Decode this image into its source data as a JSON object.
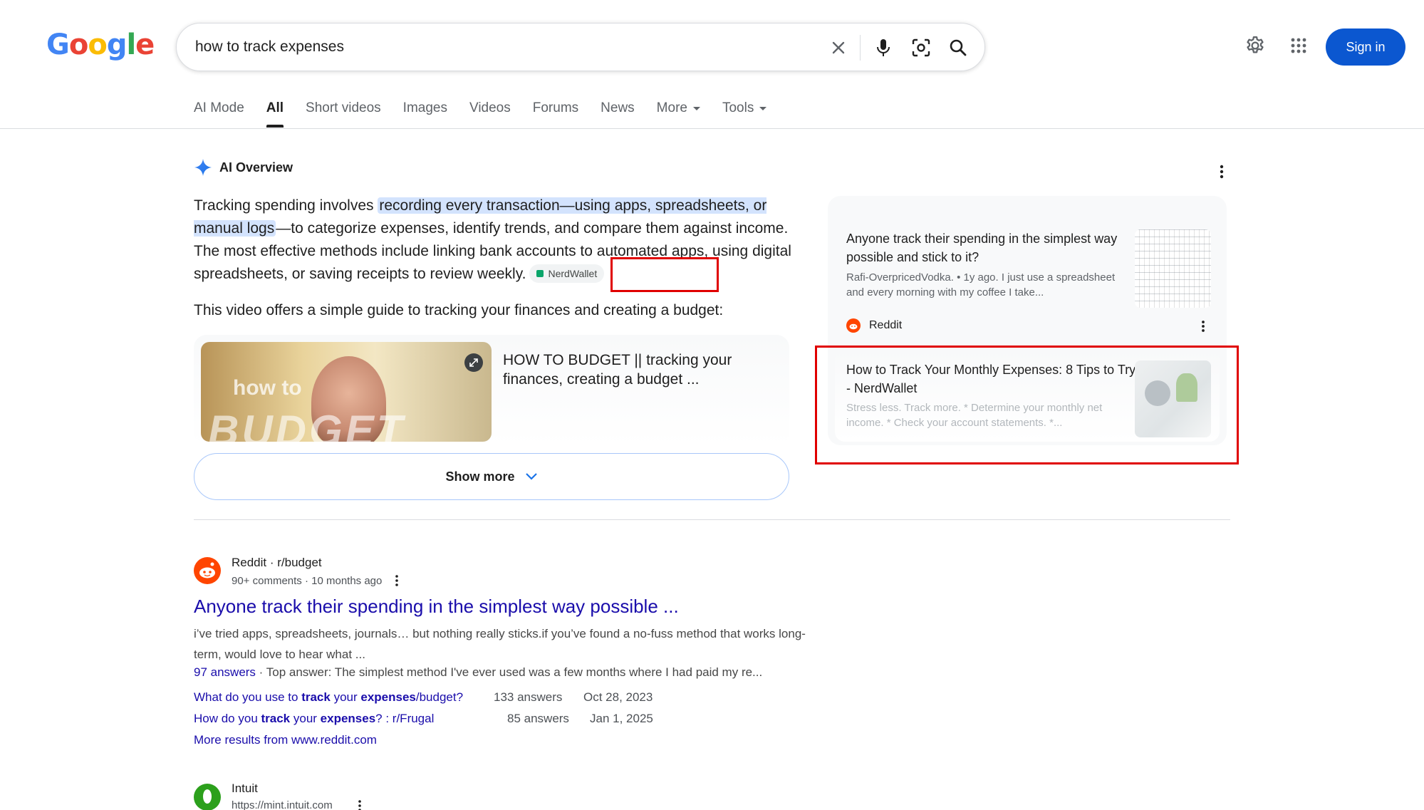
{
  "logo": {
    "letters": [
      "G",
      "o",
      "o",
      "g",
      "l",
      "e"
    ],
    "colors": [
      "#4285f4",
      "#ea4335",
      "#fbbc05",
      "#4285f4",
      "#34a853",
      "#ea4335"
    ]
  },
  "search": {
    "query": "how to track expenses",
    "placeholder": ""
  },
  "header": {
    "sign_in_label": "Sign in"
  },
  "tabs": [
    {
      "label": "AI Mode"
    },
    {
      "label": "All"
    },
    {
      "label": "Short videos"
    },
    {
      "label": "Images"
    },
    {
      "label": "Videos"
    },
    {
      "label": "Forums"
    },
    {
      "label": "News"
    },
    {
      "label": "More"
    },
    {
      "label": "Tools"
    }
  ],
  "ai_overview": {
    "title": "AI Overview",
    "text_before": "Tracking spending involves ",
    "highlight": "recording every transaction—using apps, spreadsheets, or manual logs",
    "text_after": "—to categorize expenses, identify trends, and compare them against income. The most effective methods include linking bank accounts to automated apps, using digital spreadsheets, or saving receipts to review weekly.",
    "citation": "NerdWallet",
    "video_intro": "This video offers a simple guide to tracking your finances and creating a budget:",
    "video": {
      "title": "HOW TO BUDGET || tracking your finances, creating a budget ...",
      "thumb_text_1": "how to",
      "thumb_text_2": "BUDGET"
    },
    "show_more_label": "Show more",
    "sources": [
      {
        "title": "Anyone track their spending in the simplest way possible and stick to it?",
        "snippet": "Rafi-OverpricedVodka. • 1y ago. I just use a spreadsheet and every morning with my coffee I take...",
        "site": "Reddit"
      },
      {
        "title": "How to Track Your Monthly Expenses: 8 Tips to Try - NerdWallet",
        "snippet": "Stress less. Track more. * Determine your monthly net income. * Check your account statements. *..."
      }
    ]
  },
  "results": [
    {
      "site": "Reddit · r/budget",
      "meta": "90+ comments · 10 months ago",
      "title": "Anyone track their spending in the simplest way possible ...",
      "snippet": "i’ve tried apps, spreadsheets, journals… but nothing really sticks.if you’ve found a no-fuss method that works long-term, would love to hear what ...",
      "answers_link": "97 answers",
      "answers_text": " · Top answer: The simplest method I've ever used was a few months where I had paid my re...",
      "sub_results": [
        {
          "parts": [
            "What do you use to ",
            "track",
            " your ",
            "expenses",
            "/budget?"
          ],
          "count": "133 answers",
          "date": "Oct 28, 2023"
        },
        {
          "parts": [
            "How do you ",
            "track",
            " your ",
            "expenses",
            "? : r/Frugal"
          ],
          "count": "85 answers",
          "date": "Jan 1, 2025"
        }
      ],
      "more_results": "More results from www.reddit.com"
    },
    {
      "site": "Intuit",
      "url": "https://mint.intuit.com"
    }
  ]
}
